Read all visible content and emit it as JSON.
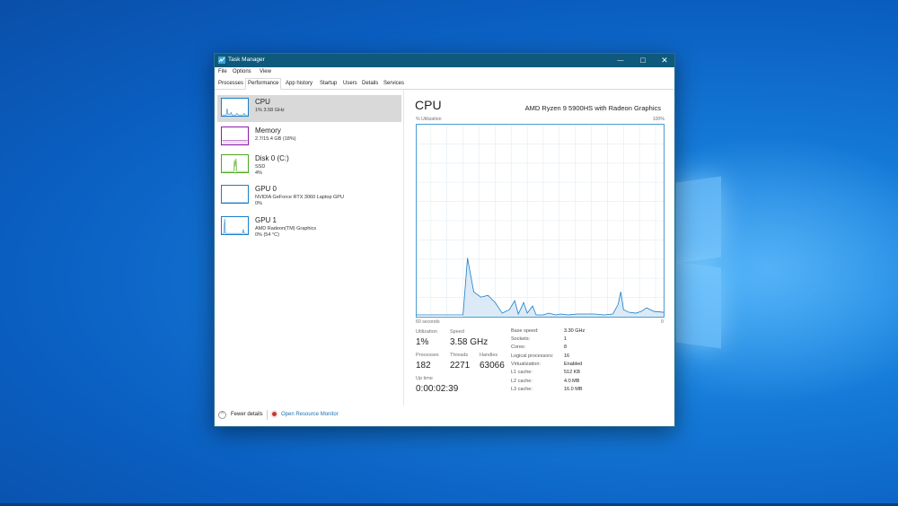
{
  "window": {
    "title": "Task Manager",
    "minimize": "—",
    "maximize": "□",
    "close": "✕"
  },
  "menu": [
    "File",
    "Options",
    "View"
  ],
  "tabs": [
    "Processes",
    "Performance",
    "App history",
    "Startup",
    "Users",
    "Details",
    "Services"
  ],
  "active_tab": "Performance",
  "sidebar": {
    "items": [
      {
        "title": "CPU",
        "sub1": "1% 3.58 GHz",
        "sub2": "",
        "color": "#1a7ec8"
      },
      {
        "title": "Memory",
        "sub1": "2.7/15.4 GB (18%)",
        "sub2": "",
        "color": "#8b1da6"
      },
      {
        "title": "Disk 0 (C:)",
        "sub1": "SSD",
        "sub2": "4%",
        "color": "#4da81f"
      },
      {
        "title": "GPU 0",
        "sub1": "NVIDIA GeForce RTX 3060 Laptop GPU",
        "sub2": "0%",
        "color": "#1a7ec8"
      },
      {
        "title": "GPU 1",
        "sub1": "AMD Radeon(TM) Graphics",
        "sub2": "0% (54 °C)",
        "color": "#1a7ec8"
      }
    ]
  },
  "main": {
    "title": "CPU",
    "model": "AMD Ryzen 9 5900HS with Radeon Graphics",
    "y_label": "% Utilization",
    "y_max": "100%",
    "x_left": "60 seconds",
    "x_right": "0",
    "stats": {
      "utilization_label": "Utilization",
      "utilization": "1%",
      "speed_label": "Speed",
      "speed": "3.58 GHz",
      "processes_label": "Processes",
      "processes": "182",
      "threads_label": "Threads",
      "threads": "2271",
      "handles_label": "Handles",
      "handles": "63066",
      "uptime_label": "Up time",
      "uptime": "0:00:02:39"
    },
    "details": [
      {
        "label": "Base speed:",
        "value": "3.30 GHz"
      },
      {
        "label": "Sockets:",
        "value": "1"
      },
      {
        "label": "Cores:",
        "value": "8"
      },
      {
        "label": "Logical processors:",
        "value": "16"
      },
      {
        "label": "Virtualization:",
        "value": "Enabled"
      },
      {
        "label": "L1 cache:",
        "value": "512 KB"
      },
      {
        "label": "L2 cache:",
        "value": "4.0 MB"
      },
      {
        "label": "L3 cache:",
        "value": "16.0 MB"
      }
    ]
  },
  "footer": {
    "fewer_details": "Fewer details",
    "open_resource_monitor": "Open Resource Monitor"
  },
  "colors": {
    "accent": "#1a7ec8",
    "titlebar": "#0f5a7c",
    "memory": "#8b1da6",
    "disk": "#4da81f"
  }
}
